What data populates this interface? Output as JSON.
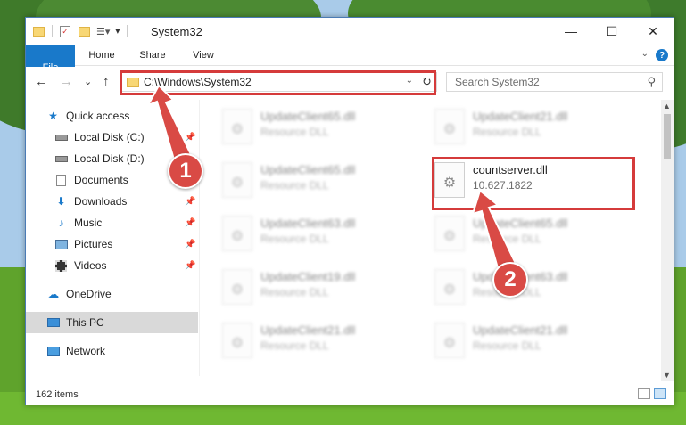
{
  "window": {
    "title": "System32",
    "controls": {
      "minimize": "—",
      "maximize": "☐",
      "close": "✕"
    }
  },
  "ribbon": {
    "tabs": [
      {
        "label": "File"
      },
      {
        "label": "Home"
      },
      {
        "label": "Share"
      },
      {
        "label": "View"
      }
    ],
    "help": "?"
  },
  "navigation": {
    "back": "←",
    "forward": "→",
    "recent": "⌄",
    "up": "↑",
    "address": "C:\\Windows\\System32",
    "refresh": "↻",
    "search_placeholder": "Search System32"
  },
  "sidebar": {
    "items": [
      {
        "label": "Quick access",
        "icon": "star-icon"
      },
      {
        "label": "Local Disk (C:)",
        "icon": "drive-icon"
      },
      {
        "label": "Local Disk (D:)",
        "icon": "drive-icon"
      },
      {
        "label": "Documents",
        "icon": "documents-icon"
      },
      {
        "label": "Downloads",
        "icon": "download-icon"
      },
      {
        "label": "Music",
        "icon": "music-icon"
      },
      {
        "label": "Pictures",
        "icon": "pictures-icon"
      },
      {
        "label": "Videos",
        "icon": "videos-icon"
      },
      {
        "label": "OneDrive",
        "icon": "cloud-icon"
      },
      {
        "label": "This PC",
        "icon": "computer-icon"
      },
      {
        "label": "Network",
        "icon": "network-icon"
      }
    ]
  },
  "files": {
    "left_column": [
      {
        "name": "UpdateClient65.dll",
        "desc": "Resource DLL"
      },
      {
        "name": "UpdateClient65.dll",
        "desc": "Resource DLL"
      },
      {
        "name": "UpdateClient63.dll",
        "desc": "Resource DLL"
      },
      {
        "name": "UpdateClient19.dll",
        "desc": "Resource DLL"
      },
      {
        "name": "UpdateClient21.dll",
        "desc": "Resource DLL"
      }
    ],
    "right_column": [
      {
        "name": "UpdateClient21.dll",
        "desc": "Resource DLL"
      },
      {
        "name": "countserver.dll",
        "desc": "10.627.1822"
      },
      {
        "name": "UpdateClient65.dll",
        "desc": "Resource DLL"
      },
      {
        "name": "UpdateClient63.dll",
        "desc": "Resource DLL"
      },
      {
        "name": "UpdateClient21.dll",
        "desc": "Resource DLL"
      }
    ]
  },
  "status": {
    "item_count": "162 items"
  },
  "callouts": [
    {
      "label": "1"
    },
    {
      "label": "2"
    }
  ],
  "colors": {
    "accent": "#1979ca",
    "highlight": "#d53b3b",
    "selected": "#d9d9d9"
  }
}
